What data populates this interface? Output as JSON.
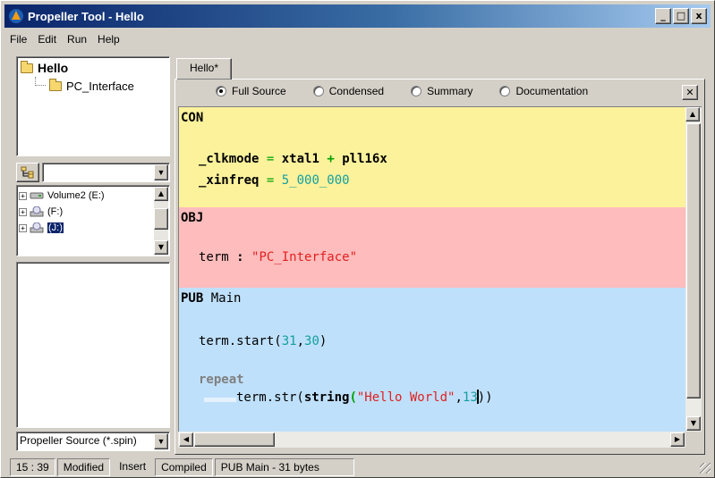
{
  "window": {
    "title": "Propeller Tool - Hello",
    "buttons": [
      "_",
      "□",
      "x"
    ]
  },
  "menu": [
    "File",
    "Edit",
    "Run",
    "Help"
  ],
  "object_tree": {
    "root": "Hello",
    "children": [
      "PC_Interface"
    ]
  },
  "drive_list": [
    "Volume2 (E:)",
    "(F:)",
    "(J:)"
  ],
  "filter": "Propeller Source (*.spin)",
  "tab": "Hello*",
  "view_modes": [
    "Full Source",
    "Condensed",
    "Summary",
    "Documentation"
  ],
  "selected_view": "Full Source",
  "code": {
    "con_header": "CON",
    "clkmode_name": "_clkmode",
    "eq1": " = ",
    "xtal": "xtal1",
    "plus": " + ",
    "pll": "pll16x",
    "xinfreq_name": "_xinfreq",
    "eq2": " = ",
    "xinfreq_val": "5_000_000",
    "obj_header": "OBJ",
    "term_name": "term",
    "colon": " : ",
    "term_file": "\"PC_Interface\"",
    "pub_kw": "PUB",
    "pub_name": " Main",
    "start_call": "term.start(",
    "start_a": "31",
    "start_comma": ",",
    "start_b": "30",
    "start_close": ")",
    "repeat_kw": "repeat",
    "str_call": "term.str(",
    "string_kw": "string",
    "paren": "(",
    "hello_str": "\"Hello World\"",
    "comma2": ",",
    "thirteen": "13",
    "close2": "))"
  },
  "status": [
    "15 : 39",
    "Modified",
    "Insert",
    "Compiled",
    "PUB Main  -  31 bytes"
  ],
  "colors": {
    "con": "#fcf29c",
    "obj": "#ffbcbc",
    "pub": "#bfe0fb",
    "number": "#139f9f",
    "string": "#e02020",
    "operator": "#00a000"
  }
}
